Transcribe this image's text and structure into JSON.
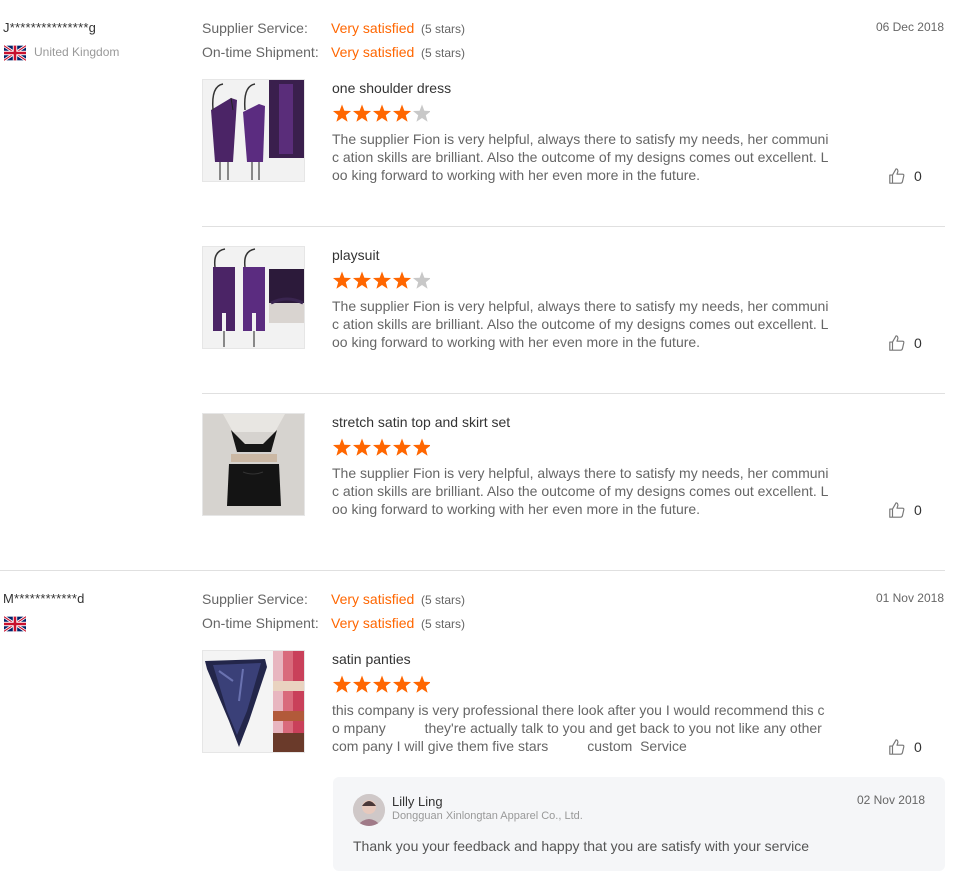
{
  "reviews": [
    {
      "user": "J***************g",
      "country": "United Kingdom",
      "flag_icon": "uk-flag-icon",
      "date": "06 Dec 2018",
      "supplier_service_label": "Supplier Service:",
      "supplier_service_value": "Very satisfied",
      "supplier_service_stars": "(5 stars)",
      "shipment_label": "On-time Shipment:",
      "shipment_value": "Very satisfied",
      "shipment_stars": "(5 stars)",
      "items": [
        {
          "title": "one shoulder dress",
          "rating": 4,
          "text": "The supplier Fion is very helpful, always there to satisfy my needs, her communic ation skills are brilliant. Also the outcome of my designs comes out excellent. Loo king forward to working with her even more in the future.",
          "likes": "0"
        },
        {
          "title": "playsuit",
          "rating": 4,
          "text": "The supplier Fion is very helpful, always there to satisfy my needs, her communic ation skills are brilliant. Also the outcome of my designs comes out excellent. Loo king forward to working with her even more in the future.",
          "likes": "0"
        },
        {
          "title": "stretch satin top and skirt set",
          "rating": 5,
          "text": "The supplier Fion is very helpful, always there to satisfy my needs, her communic ation skills are brilliant. Also the outcome of my designs comes out excellent. Loo king forward to working with her even more in the future.",
          "likes": "0"
        }
      ]
    },
    {
      "user": "M************d",
      "country": "",
      "flag_icon": "uk-flag-icon",
      "date": "01 Nov 2018",
      "supplier_service_label": "Supplier Service:",
      "supplier_service_value": "Very satisfied",
      "supplier_service_stars": "(5 stars)",
      "shipment_label": "On-time Shipment:",
      "shipment_value": "Very satisfied",
      "shipment_stars": "(5 stars)",
      "items": [
        {
          "title": "satin panties",
          "rating": 5,
          "text": "this company is very professional there look after you I would recommend this co mpany          they're actually talk to you and get back to you not like any other com pany I will give them five stars          custom  Service",
          "likes": "0"
        }
      ],
      "reply": {
        "name": "Lilly Ling",
        "company": "Dongguan Xinlongtan Apparel Co., Ltd.",
        "date": "02 Nov 2018",
        "text": "Thank you your feedback and happy that you are satisfy with your service"
      }
    }
  ],
  "colors": {
    "accent": "#ff6600",
    "star_empty": "#c8c8c8",
    "reply_bg": "#f5f6f8"
  }
}
